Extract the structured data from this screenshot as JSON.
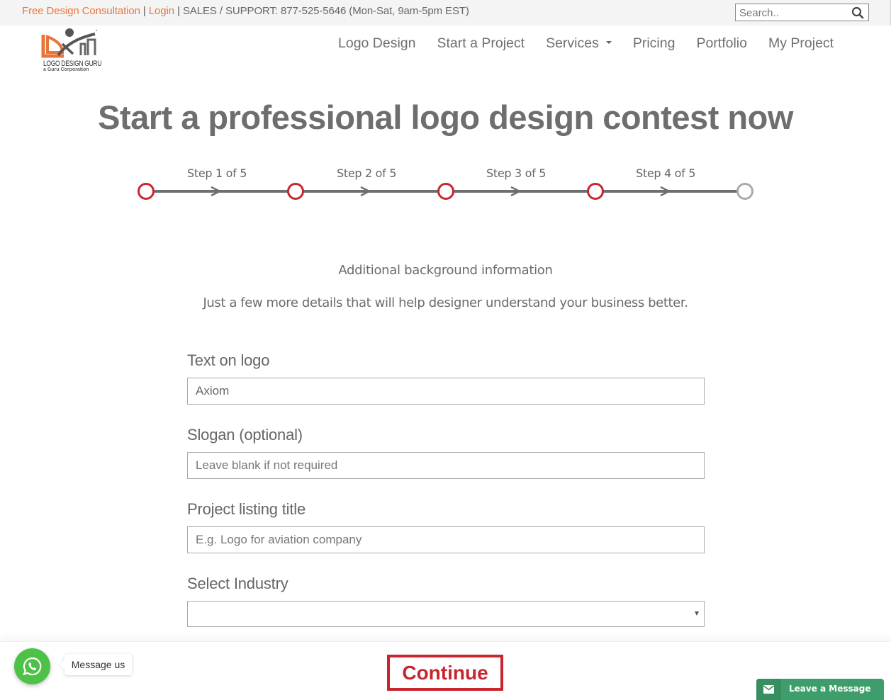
{
  "topbar": {
    "consultation_link": "Free Design Consultation",
    "separator": " | ",
    "login_link": "Login",
    "support_text": "SALES / SUPPORT: 877-525-5646 (Mon-Sat, 9am-5pm EST)",
    "search_placeholder": "Search..",
    "search_icon": "magnifier-icon"
  },
  "logo": {
    "name": "LOGO DESIGN GURU",
    "tagline": "a Guru Corporation",
    "colors": {
      "orange": "#e8763a",
      "gray": "#555555"
    }
  },
  "nav": {
    "items": [
      {
        "label": "Logo Design"
      },
      {
        "label": "Start a Project"
      },
      {
        "label": "Services",
        "has_dropdown": true
      },
      {
        "label": "Pricing"
      },
      {
        "label": "Portfolio"
      },
      {
        "label": "My Project"
      }
    ]
  },
  "page": {
    "title": "Start a professional logo design contest now"
  },
  "steps": {
    "items": [
      {
        "label": "Step 1 of 5",
        "status": "complete"
      },
      {
        "label": "Step 2 of 5",
        "status": "complete"
      },
      {
        "label": "Step 3 of 5",
        "status": "complete"
      },
      {
        "label": "Step 4 of 5",
        "status": "current"
      },
      {
        "label": "",
        "status": "pending"
      }
    ],
    "current_step": 4,
    "total_steps": 5,
    "colors": {
      "active": "#c8262e",
      "pending": "#aaaaaa",
      "line": "#6e6e6e"
    }
  },
  "intro": {
    "title": "Additional background information",
    "subtitle": "Just a few more details that will help designer understand your business better."
  },
  "form": {
    "text_on_logo": {
      "label": "Text on logo",
      "value": "Axiom",
      "placeholder": ""
    },
    "slogan": {
      "label": "Slogan (optional)",
      "value": "",
      "placeholder": "Leave blank if not required"
    },
    "listing_title": {
      "label": "Project listing title",
      "value": "",
      "placeholder": "E.g. Logo for aviation company"
    },
    "industry": {
      "label": "Select Industry",
      "selected": ""
    }
  },
  "footer": {
    "continue_label": "Continue",
    "whatsapp_tooltip": "Message us",
    "leave_message_label": "Leave a Message",
    "colors": {
      "continue": "#c8262e",
      "whatsapp": "#4dc247",
      "leave_message": "#3e9e6b"
    }
  }
}
